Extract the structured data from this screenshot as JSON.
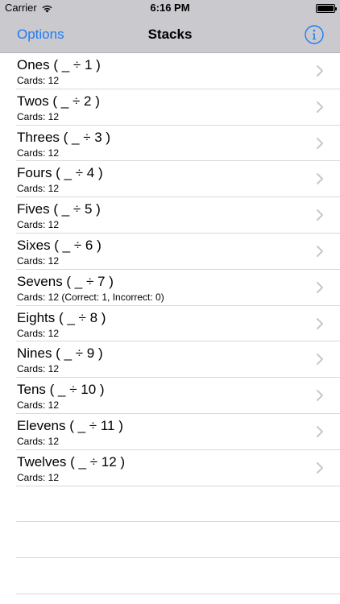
{
  "status": {
    "carrier": "Carrier",
    "time": "6:16 PM"
  },
  "nav": {
    "left": "Options",
    "title": "Stacks",
    "accent": "#1e7cf5"
  },
  "stacks": [
    {
      "title": "Ones ( _ ÷ 1 )",
      "sub": "Cards: 12"
    },
    {
      "title": "Twos ( _ ÷ 2 )",
      "sub": "Cards: 12"
    },
    {
      "title": "Threes ( _ ÷ 3 )",
      "sub": "Cards: 12"
    },
    {
      "title": "Fours ( _ ÷ 4 )",
      "sub": "Cards: 12"
    },
    {
      "title": "Fives ( _ ÷ 5 )",
      "sub": "Cards: 12"
    },
    {
      "title": "Sixes ( _ ÷ 6 )",
      "sub": "Cards: 12"
    },
    {
      "title": "Sevens ( _ ÷ 7 )",
      "sub": "Cards: 12 (Correct: 1, Incorrect: 0)"
    },
    {
      "title": "Eights ( _ ÷ 8 )",
      "sub": "Cards: 12"
    },
    {
      "title": "Nines ( _ ÷ 9 )",
      "sub": "Cards: 12"
    },
    {
      "title": "Tens ( _ ÷ 10 )",
      "sub": "Cards: 12"
    },
    {
      "title": "Elevens ( _ ÷ 11 )",
      "sub": "Cards: 12"
    },
    {
      "title": "Twelves ( _ ÷ 12 )",
      "sub": "Cards: 12"
    }
  ]
}
